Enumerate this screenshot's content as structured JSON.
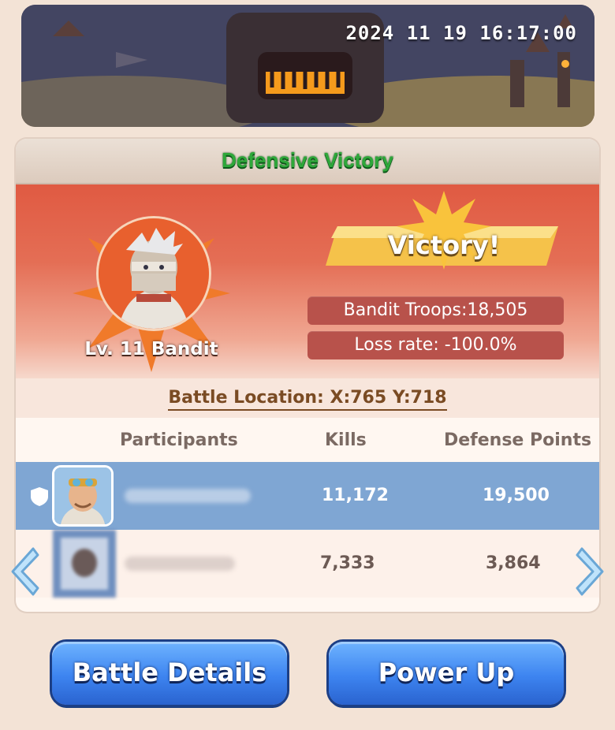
{
  "banner": {
    "timestamp": "2024 11 19 16:17:00"
  },
  "report": {
    "result_title": "Defensive Victory",
    "outcome": "Victory!",
    "enemy_name": "Lv. 11 Bandit",
    "bandit_troops": "Bandit Troops:18,505",
    "loss_rate": "Loss rate: -100.0%",
    "battle_location": "Battle Location: X:765 Y:718"
  },
  "table": {
    "headers": [
      "Participants",
      "Kills",
      "Defense Points"
    ],
    "rows": [
      {
        "kills": "11,172",
        "defense_points": "19,500",
        "highlighted": true
      },
      {
        "kills": "7,333",
        "defense_points": "3,864",
        "highlighted": false
      }
    ]
  },
  "buttons": {
    "battle_details": "Battle Details",
    "power_up": "Power Up"
  },
  "icons": [
    "shield-icon",
    "arrow-left-icon",
    "arrow-right-icon"
  ],
  "colors": {
    "victory_green": "#2ea83a",
    "hero_red": "#e05a42",
    "row_highlight": "#7fa6d3",
    "button_blue": "#3d84f0"
  }
}
